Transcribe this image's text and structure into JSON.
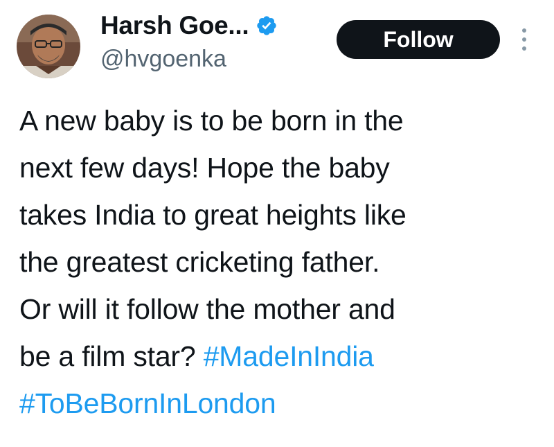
{
  "author": {
    "display_name": "Harsh Goe...",
    "handle": "@hvgoenka",
    "verified": true,
    "avatar_icon": "profile-photo"
  },
  "actions": {
    "follow_label": "Follow",
    "more_icon": "more-vertical-icon"
  },
  "tweet": {
    "lines": [
      "A new baby is to be born in the",
      "next few days! Hope the baby",
      "takes India to great heights like",
      "the greatest cricketing father.",
      "Or will it follow the mother and"
    ],
    "last_line_text": "be a film star?",
    "hashtags": [
      "#MadeInIndia",
      "#ToBeBornInLondon"
    ]
  },
  "colors": {
    "text": "#0f1419",
    "secondary_text": "#536471",
    "link": "#1d9bf0",
    "verified_badge": "#1d9bf0",
    "follow_bg": "#0f1419",
    "follow_text": "#ffffff"
  }
}
